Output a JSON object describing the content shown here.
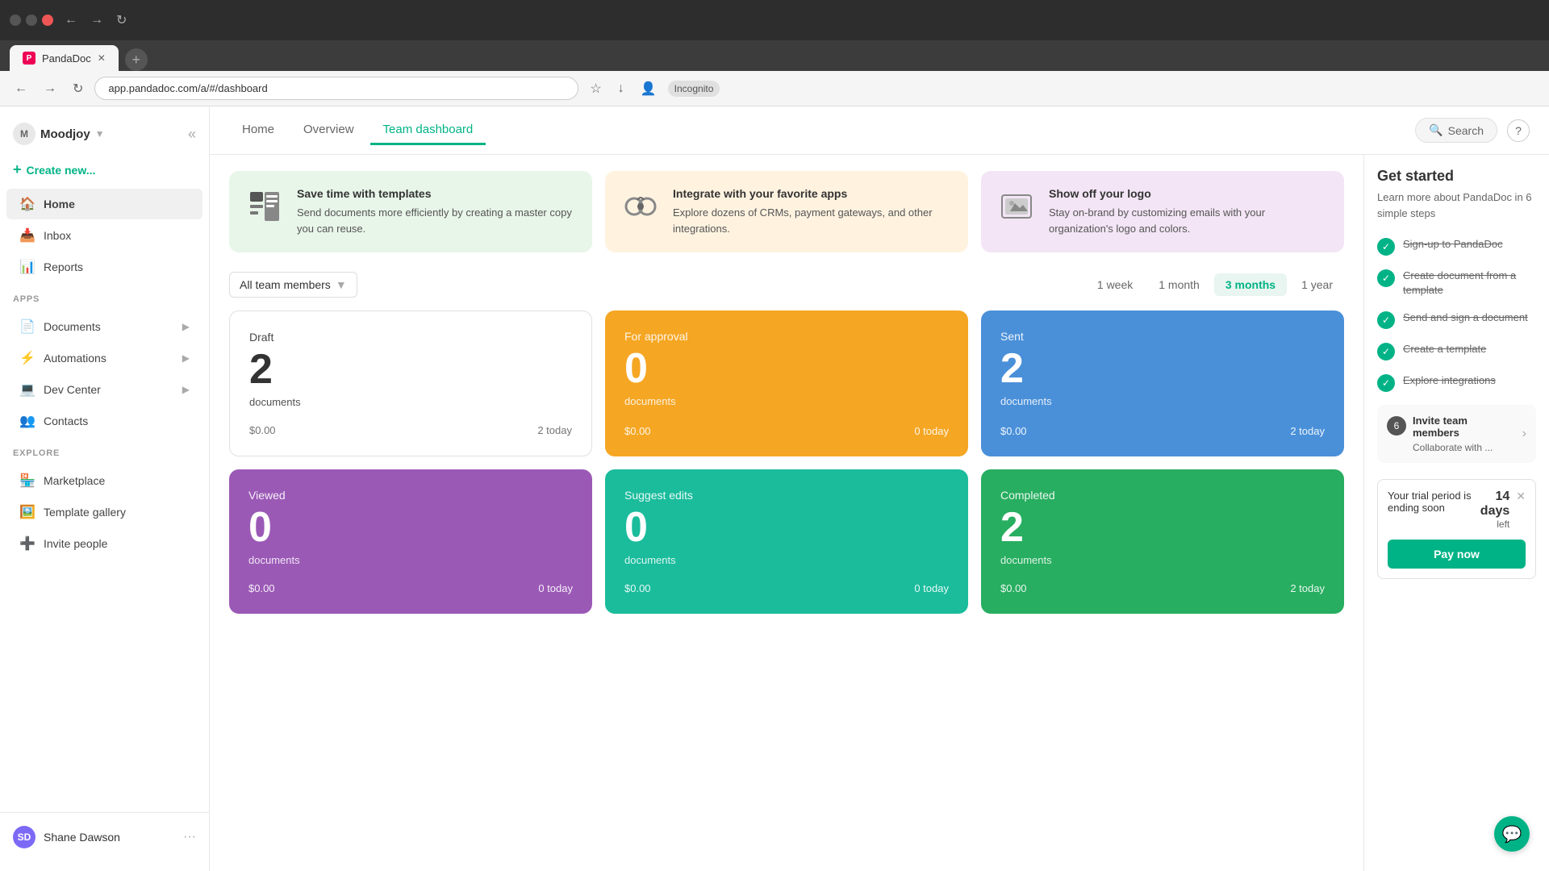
{
  "browser": {
    "url": "app.pandadoc.com/a/#/dashboard",
    "tab_title": "PandaDoc",
    "incognito_label": "Incognito"
  },
  "sidebar": {
    "workspace": "Moodjoy",
    "create_label": "Create new...",
    "nav_items": [
      {
        "id": "home",
        "label": "Home",
        "icon": "🏠",
        "active": true
      },
      {
        "id": "inbox",
        "label": "Inbox",
        "icon": "📥",
        "active": false
      },
      {
        "id": "reports",
        "label": "Reports",
        "icon": "📊",
        "active": false
      }
    ],
    "apps_label": "APPS",
    "app_items": [
      {
        "id": "documents",
        "label": "Documents",
        "icon": "📄",
        "has_chevron": true
      },
      {
        "id": "automations",
        "label": "Automations",
        "icon": "⚡",
        "has_chevron": true
      },
      {
        "id": "dev-center",
        "label": "Dev Center",
        "icon": "💻",
        "has_chevron": true
      },
      {
        "id": "contacts",
        "label": "Contacts",
        "icon": "👥",
        "has_chevron": false
      }
    ],
    "explore_label": "EXPLORE",
    "explore_items": [
      {
        "id": "marketplace",
        "label": "Marketplace",
        "icon": "🏪"
      },
      {
        "id": "template-gallery",
        "label": "Template gallery",
        "icon": "🖼️"
      },
      {
        "id": "invite-people",
        "label": "Invite people",
        "icon": "➕"
      }
    ],
    "user": {
      "name": "Shane Dawson",
      "initials": "SD"
    }
  },
  "header": {
    "tabs": [
      {
        "id": "home",
        "label": "Home",
        "active": false
      },
      {
        "id": "overview",
        "label": "Overview",
        "active": false
      },
      {
        "id": "team-dashboard",
        "label": "Team dashboard",
        "active": true
      }
    ],
    "search_label": "Search",
    "help_label": "?"
  },
  "promo_cards": [
    {
      "id": "templates",
      "title": "Save time with templates",
      "desc": "Send documents more efficiently by creating a master copy you can reuse.",
      "icon": "📋",
      "theme": "green"
    },
    {
      "id": "integrations",
      "title": "Integrate with your favorite apps",
      "desc": "Explore dozens of CRMs, payment gateways, and other integrations.",
      "icon": "🔧",
      "theme": "orange"
    },
    {
      "id": "logo",
      "title": "Show off your logo",
      "desc": "Stay on-brand by customizing emails with your organization's logo and colors.",
      "icon": "🖼️",
      "theme": "purple"
    }
  ],
  "filters": {
    "team_placeholder": "All team members",
    "time_options": [
      {
        "id": "week",
        "label": "1 week"
      },
      {
        "id": "month",
        "label": "1 month"
      },
      {
        "id": "3months",
        "label": "3 months",
        "active": true
      },
      {
        "id": "year",
        "label": "1 year"
      }
    ]
  },
  "stats": [
    {
      "id": "draft",
      "label": "Draft",
      "number": "2",
      "sublabel": "documents",
      "amount": "$0.00",
      "today": "2 today",
      "theme": "white"
    },
    {
      "id": "for-approval",
      "label": "For approval",
      "number": "0",
      "sublabel": "documents",
      "amount": "$0.00",
      "today": "0 today",
      "theme": "orange"
    },
    {
      "id": "sent",
      "label": "Sent",
      "number": "2",
      "sublabel": "documents",
      "amount": "$0.00",
      "today": "2 today",
      "theme": "blue"
    },
    {
      "id": "viewed",
      "label": "Viewed",
      "number": "0",
      "sublabel": "documents",
      "amount": "$0.00",
      "today": "0 today",
      "theme": "purple"
    },
    {
      "id": "suggest-edits",
      "label": "Suggest edits",
      "number": "0",
      "sublabel": "documents",
      "amount": "$0.00",
      "today": "0 today",
      "theme": "teal"
    },
    {
      "id": "completed",
      "label": "Completed",
      "number": "2",
      "sublabel": "documents",
      "amount": "$0.00",
      "today": "2 today",
      "theme": "green"
    }
  ],
  "get_started": {
    "title": "Get started",
    "subtitle": "Learn more about PandaDoc in 6 simple steps",
    "steps": [
      {
        "id": "signup",
        "label": "Sign-up to PandaDoc",
        "done": true
      },
      {
        "id": "create-doc",
        "label": "Create document from a template",
        "done": true
      },
      {
        "id": "send-sign",
        "label": "Send and sign a document",
        "done": true
      },
      {
        "id": "create-template",
        "label": "Create a template",
        "done": true
      },
      {
        "id": "explore-int",
        "label": "Explore integrations",
        "done": true
      }
    ],
    "invite": {
      "number": "6",
      "title": "Invite team members",
      "desc": "Collaborate with ..."
    }
  },
  "trial": {
    "text": "Your trial period is ending soon",
    "days": "14 days",
    "left": "left",
    "pay_label": "Pay now"
  }
}
